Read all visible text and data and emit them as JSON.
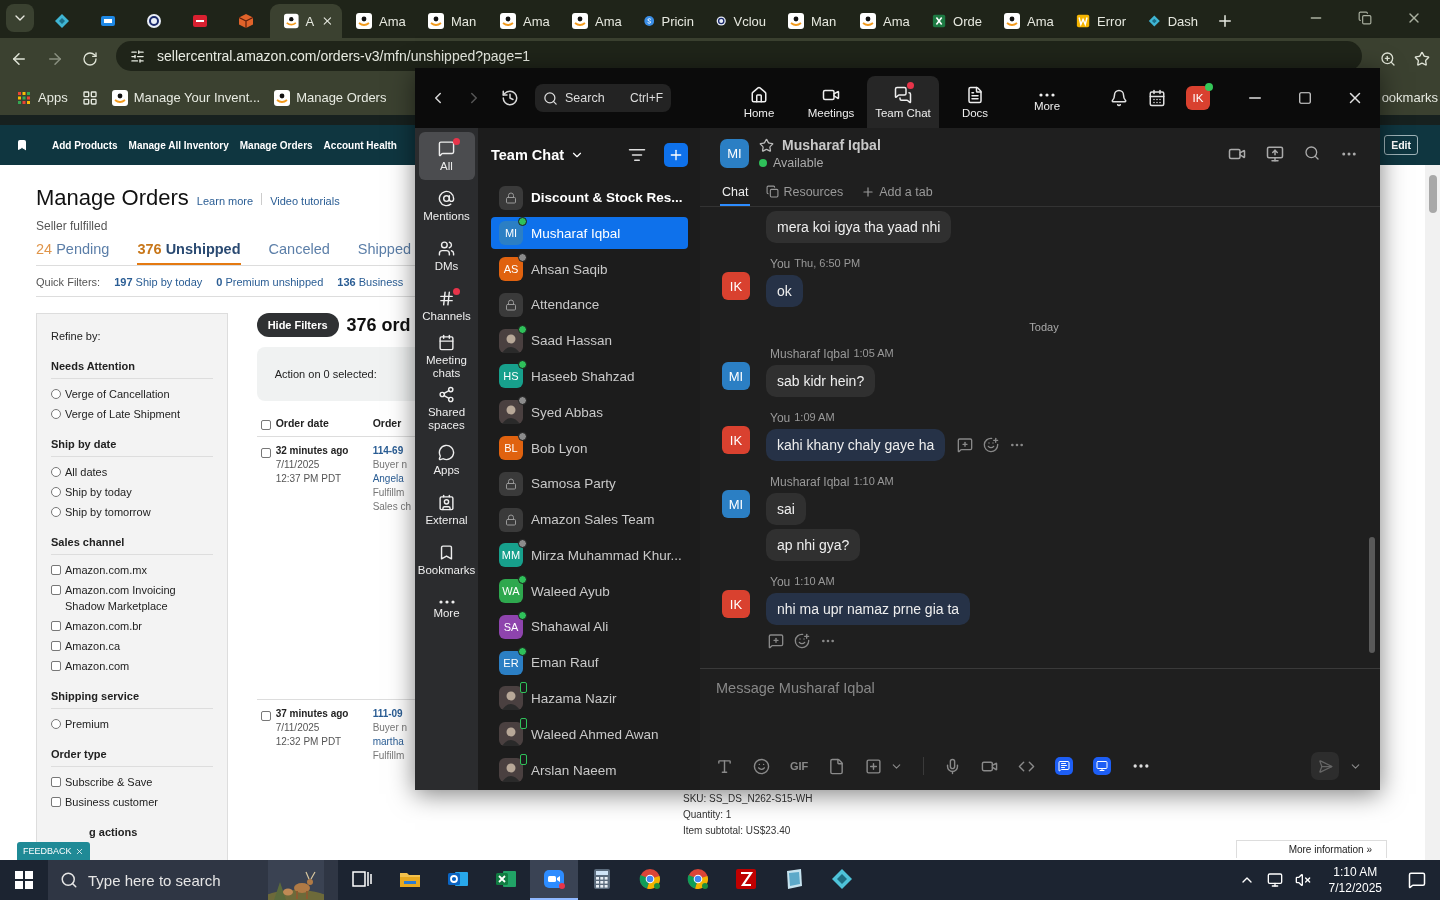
{
  "browser": {
    "tabs": [
      {
        "kind": "diamond",
        "selected": false
      },
      {
        "kind": "ec",
        "selected": false
      },
      {
        "kind": "ring",
        "selected": false
      },
      {
        "kind": "red",
        "selected": false
      },
      {
        "kind": "cube",
        "selected": false
      },
      {
        "kind": "amazon",
        "title": "A",
        "selected": true
      },
      {
        "kind": "amazon",
        "title": "Ama",
        "selected": false
      },
      {
        "kind": "amazon",
        "title": "Man",
        "selected": false
      },
      {
        "kind": "amazon",
        "title": "Ama",
        "selected": false
      },
      {
        "kind": "amazon",
        "title": "Ama",
        "selected": false
      },
      {
        "kind": "pricing",
        "title": "Pricin",
        "selected": false
      },
      {
        "kind": "ring",
        "title": "Vclou",
        "selected": false
      },
      {
        "kind": "amazon",
        "title": "Man",
        "selected": false
      },
      {
        "kind": "amazon",
        "title": "Ama",
        "selected": false
      },
      {
        "kind": "excel",
        "title": "Orde",
        "selected": false
      },
      {
        "kind": "amazon",
        "title": "Ama",
        "selected": false
      },
      {
        "kind": "word",
        "title": "Error",
        "selected": false
      },
      {
        "kind": "diamond",
        "title": "Dash",
        "selected": false
      }
    ],
    "url": "sellercentral.amazon.com/orders-v3/mfn/unshipped?page=1",
    "bookmarks": [
      {
        "kind": "apps",
        "label": "Apps"
      },
      {
        "kind": "grid"
      },
      {
        "kind": "amazon",
        "label": "Manage Your Invent..."
      },
      {
        "kind": "amazon",
        "label": "Manage Orders"
      }
    ],
    "bookmarks_overflow": "ookmarks"
  },
  "amazon": {
    "nav": [
      "Add Products",
      "Manage All Inventory",
      "Manage Orders",
      "Account Health"
    ],
    "edit": "Edit",
    "title": "Manage Orders",
    "links": [
      "Learn more",
      "Video tutorials"
    ],
    "subtitle": "Seller fulfilled",
    "tabs": [
      {
        "count": "24",
        "label": "Pending",
        "selected": false
      },
      {
        "count": "376",
        "label": "Unshipped",
        "selected": true
      },
      {
        "label": "Canceled",
        "selected": false
      },
      {
        "label": "Shipped",
        "selected": false
      }
    ],
    "quick_filters": {
      "label": "Quick Filters:",
      "items": [
        {
          "count": "197",
          "label": "Ship by today"
        },
        {
          "count": "0",
          "label": "Premium unshipped"
        },
        {
          "count": "136",
          "label": "Business"
        }
      ]
    },
    "refine": "Refine by:",
    "filter_sections": [
      {
        "title": "Needs Attention",
        "options": [
          {
            "kind": "radio",
            "label": "Verge of Cancellation",
            "checked": false
          },
          {
            "kind": "radio",
            "label": "Verge of Late Shipment",
            "checked": false
          }
        ]
      },
      {
        "title": "Ship by date",
        "options": [
          {
            "kind": "radio",
            "label": "All dates",
            "checked": false
          },
          {
            "kind": "radio",
            "label": "Ship by today",
            "checked": false
          },
          {
            "kind": "radio",
            "label": "Ship by tomorrow",
            "checked": false
          }
        ]
      },
      {
        "title": "Sales channel",
        "options": [
          {
            "kind": "checkbox",
            "label": "Amazon.com.mx",
            "checked": false
          },
          {
            "kind": "checkbox",
            "label": "Amazon.com Invoicing Shadow Marketplace",
            "checked": false
          },
          {
            "kind": "checkbox",
            "label": "Amazon.com.br",
            "checked": false
          },
          {
            "kind": "checkbox",
            "label": "Amazon.ca",
            "checked": false
          },
          {
            "kind": "checkbox",
            "label": "Amazon.com",
            "checked": false
          }
        ]
      },
      {
        "title": "Shipping service",
        "options": [
          {
            "kind": "radio",
            "label": "Premium",
            "checked": false
          }
        ]
      },
      {
        "title": "Order type",
        "options": [
          {
            "kind": "checkbox",
            "label": "Subscribe & Save",
            "checked": false
          },
          {
            "kind": "checkbox",
            "label": "Business customer",
            "checked": false
          }
        ]
      },
      {
        "title": "g actions"
      }
    ],
    "feedback": "FEEDBACK",
    "hide_filters": "Hide Filters",
    "order_count": "376 ord",
    "action_label": "Action on 0 selected:",
    "columns": [
      "Order date",
      "Order"
    ],
    "select_all": false,
    "orders": [
      {
        "checked": false,
        "ago": "32 minutes ago",
        "date": "7/11/2025",
        "time": "12:37 PM PDT",
        "id": "114-69",
        "lines": [
          "Buyer n",
          "Angela",
          "Fulfillm",
          "Sales ch"
        ]
      },
      {
        "checked": false,
        "ago": "37 minutes ago",
        "date": "7/11/2025",
        "time": "12:32 PM PDT",
        "id": "111-09",
        "lines": [
          "Buyer n",
          "martha",
          "Fulfillm"
        ]
      }
    ],
    "details": [
      "SKU: SS_DS_N262-S15-WH",
      "Quantity: 1",
      "Item subtotal: US$23.40"
    ],
    "more_info": "More information »"
  },
  "zoom": {
    "search": "Search",
    "shortcut": "Ctrl+F",
    "nav": [
      {
        "label": "Home",
        "selected": false,
        "badge": false
      },
      {
        "label": "Meetings",
        "selected": false,
        "badge": false
      },
      {
        "label": "Team Chat",
        "selected": true,
        "badge": true
      },
      {
        "label": "Docs",
        "selected": false,
        "badge": false
      },
      {
        "label": "More",
        "selected": false,
        "badge": false
      }
    ],
    "user": "IK",
    "rail": [
      {
        "label": "All",
        "selected": true,
        "badge": true
      },
      {
        "label": "Mentions",
        "selected": false,
        "badge": false
      },
      {
        "label": "DMs",
        "selected": false,
        "badge": false
      },
      {
        "label": "Channels",
        "selected": false,
        "badge": true
      },
      {
        "label": "Meeting chats",
        "selected": false,
        "badge": false
      },
      {
        "label": "Shared spaces",
        "selected": false,
        "badge": false
      },
      {
        "label": "Apps",
        "selected": false,
        "badge": false
      },
      {
        "label": "External",
        "selected": false,
        "badge": false
      },
      {
        "label": "Bookmarks",
        "selected": false,
        "badge": false
      },
      {
        "label": "More",
        "selected": false,
        "badge": false
      }
    ],
    "list_title": "Team Chat",
    "chats": [
      {
        "kind": "lock",
        "name": "Discount & Stock Res...",
        "unread": true,
        "selected": false
      },
      {
        "kind": "initials",
        "name": "Musharaf Iqbal",
        "initials": "MI",
        "color": "#2b7fc4",
        "presence": {
          "kind": "online"
        },
        "unread": false,
        "selected": true
      },
      {
        "kind": "initials",
        "name": "Ahsan Saqib",
        "initials": "AS",
        "color": "#e0620f",
        "presence": {
          "kind": "away"
        },
        "unread": false,
        "selected": false
      },
      {
        "kind": "lock",
        "name": "Attendance",
        "unread": false,
        "selected": false
      },
      {
        "name": "Saad Hassan",
        "presence": {
          "kind": "online"
        },
        "unread": false,
        "selected": false
      },
      {
        "kind": "initials",
        "name": "Haseeb Shahzad",
        "initials": "HS",
        "color": "#17a08c",
        "presence": {
          "kind": "online"
        },
        "unread": false,
        "selected": false
      },
      {
        "name": "Syed Abbas",
        "presence": {
          "kind": "away"
        },
        "unread": false,
        "selected": false
      },
      {
        "kind": "initials",
        "name": "Bob Lyon",
        "initials": "BL",
        "color": "#e0620f",
        "presence": {
          "kind": "away"
        },
        "unread": false,
        "selected": false
      },
      {
        "kind": "lock",
        "name": "Samosa Party",
        "unread": false,
        "selected": false
      },
      {
        "kind": "lock",
        "name": "Amazon Sales Team",
        "unread": false,
        "selected": false
      },
      {
        "kind": "initials",
        "name": "Mirza Muhammad Khur...",
        "initials": "MM",
        "color": "#17a08c",
        "presence": {
          "kind": "away"
        },
        "unread": false,
        "selected": false
      },
      {
        "kind": "initials",
        "name": "Waleed Ayub",
        "initials": "WA",
        "color": "#2ea84e",
        "presence": {
          "kind": "online"
        },
        "unread": false,
        "selected": false
      },
      {
        "kind": "initials",
        "name": "Shahawal Ali",
        "initials": "SA",
        "color": "#8e44ad",
        "presence": {
          "kind": "online"
        },
        "unread": false,
        "selected": false
      },
      {
        "kind": "initials",
        "name": "Eman Rauf",
        "initials": "ER",
        "color": "#2b7fc4",
        "presence": {
          "kind": "online"
        },
        "unread": false,
        "selected": false
      },
      {
        "name": "Hazama Nazir",
        "presence": {
          "kind": "mobile"
        },
        "unread": false,
        "selected": false
      },
      {
        "name": "Waleed Ahmed Awan",
        "presence": {
          "kind": "mobile"
        },
        "unread": false,
        "selected": false
      },
      {
        "name": "Arslan Naeem",
        "presence": {
          "kind": "mobile"
        },
        "unread": false,
        "selected": false
      }
    ],
    "conversation": {
      "initials": "MI",
      "color": "#2b7fc4",
      "name": "Musharaf Iqbal",
      "status": "Available",
      "online": true,
      "tabs": [
        {
          "label": "Chat",
          "selected": true
        },
        {
          "label": "Resources",
          "selected": false
        },
        {
          "label": "Add a tab",
          "selected": false
        }
      ],
      "messages": [
        {
          "kind": "message",
          "mine": false,
          "bubbles": [
            "mera koi igya tha yaad nhi"
          ]
        },
        {
          "kind": "message",
          "mine": true,
          "sender": "You",
          "time": "Thu, 6:50 PM",
          "initials": "IK",
          "color": "#d9412f",
          "bubbles": [
            "ok"
          ]
        },
        {
          "kind": "separator",
          "label": "Today"
        },
        {
          "kind": "message",
          "mine": false,
          "sender": "Musharaf Iqbal",
          "time": "1:05 AM",
          "initials": "MI",
          "color": "#2b7fc4",
          "bubbles": [
            "sab kidr hein?"
          ]
        },
        {
          "kind": "message",
          "mine": true,
          "sender": "You",
          "time": "1:09 AM",
          "initials": "IK",
          "color": "#d9412f",
          "bubbles": [
            "kahi khany chaly gaye ha"
          ],
          "hover_actions": {
            "kind": "inline"
          }
        },
        {
          "kind": "message",
          "mine": false,
          "sender": "Musharaf Iqbal",
          "time": "1:10 AM",
          "initials": "MI",
          "color": "#2b7fc4",
          "bubbles": [
            "sai",
            "ap nhi gya?"
          ]
        },
        {
          "kind": "message",
          "mine": true,
          "sender": "You",
          "time": "1:10 AM",
          "initials": "IK",
          "color": "#d9412f",
          "bubbles": [
            "nhi ma upr namaz prne gia ta"
          ],
          "hover_actions": {
            "kind": "below"
          }
        }
      ],
      "placeholder": "Message Musharaf Iqbal",
      "gif": "GIF"
    }
  },
  "taskbar": {
    "search": "Type here to search",
    "apps": [
      {
        "kind": "taskview",
        "selected": false
      },
      {
        "kind": "explorer",
        "selected": false
      },
      {
        "kind": "outlook",
        "selected": false
      },
      {
        "kind": "excel",
        "selected": false
      },
      {
        "kind": "zoom",
        "selected": true
      },
      {
        "kind": "calculator",
        "selected": false
      },
      {
        "kind": "chrome",
        "selected": false
      },
      {
        "kind": "chrome",
        "selected": false
      },
      {
        "kind": "filezilla",
        "selected": false
      },
      {
        "kind": "notebook",
        "selected": false
      },
      {
        "kind": "diamond",
        "selected": false
      }
    ],
    "time": "1:10 AM",
    "date": "7/12/2025"
  }
}
